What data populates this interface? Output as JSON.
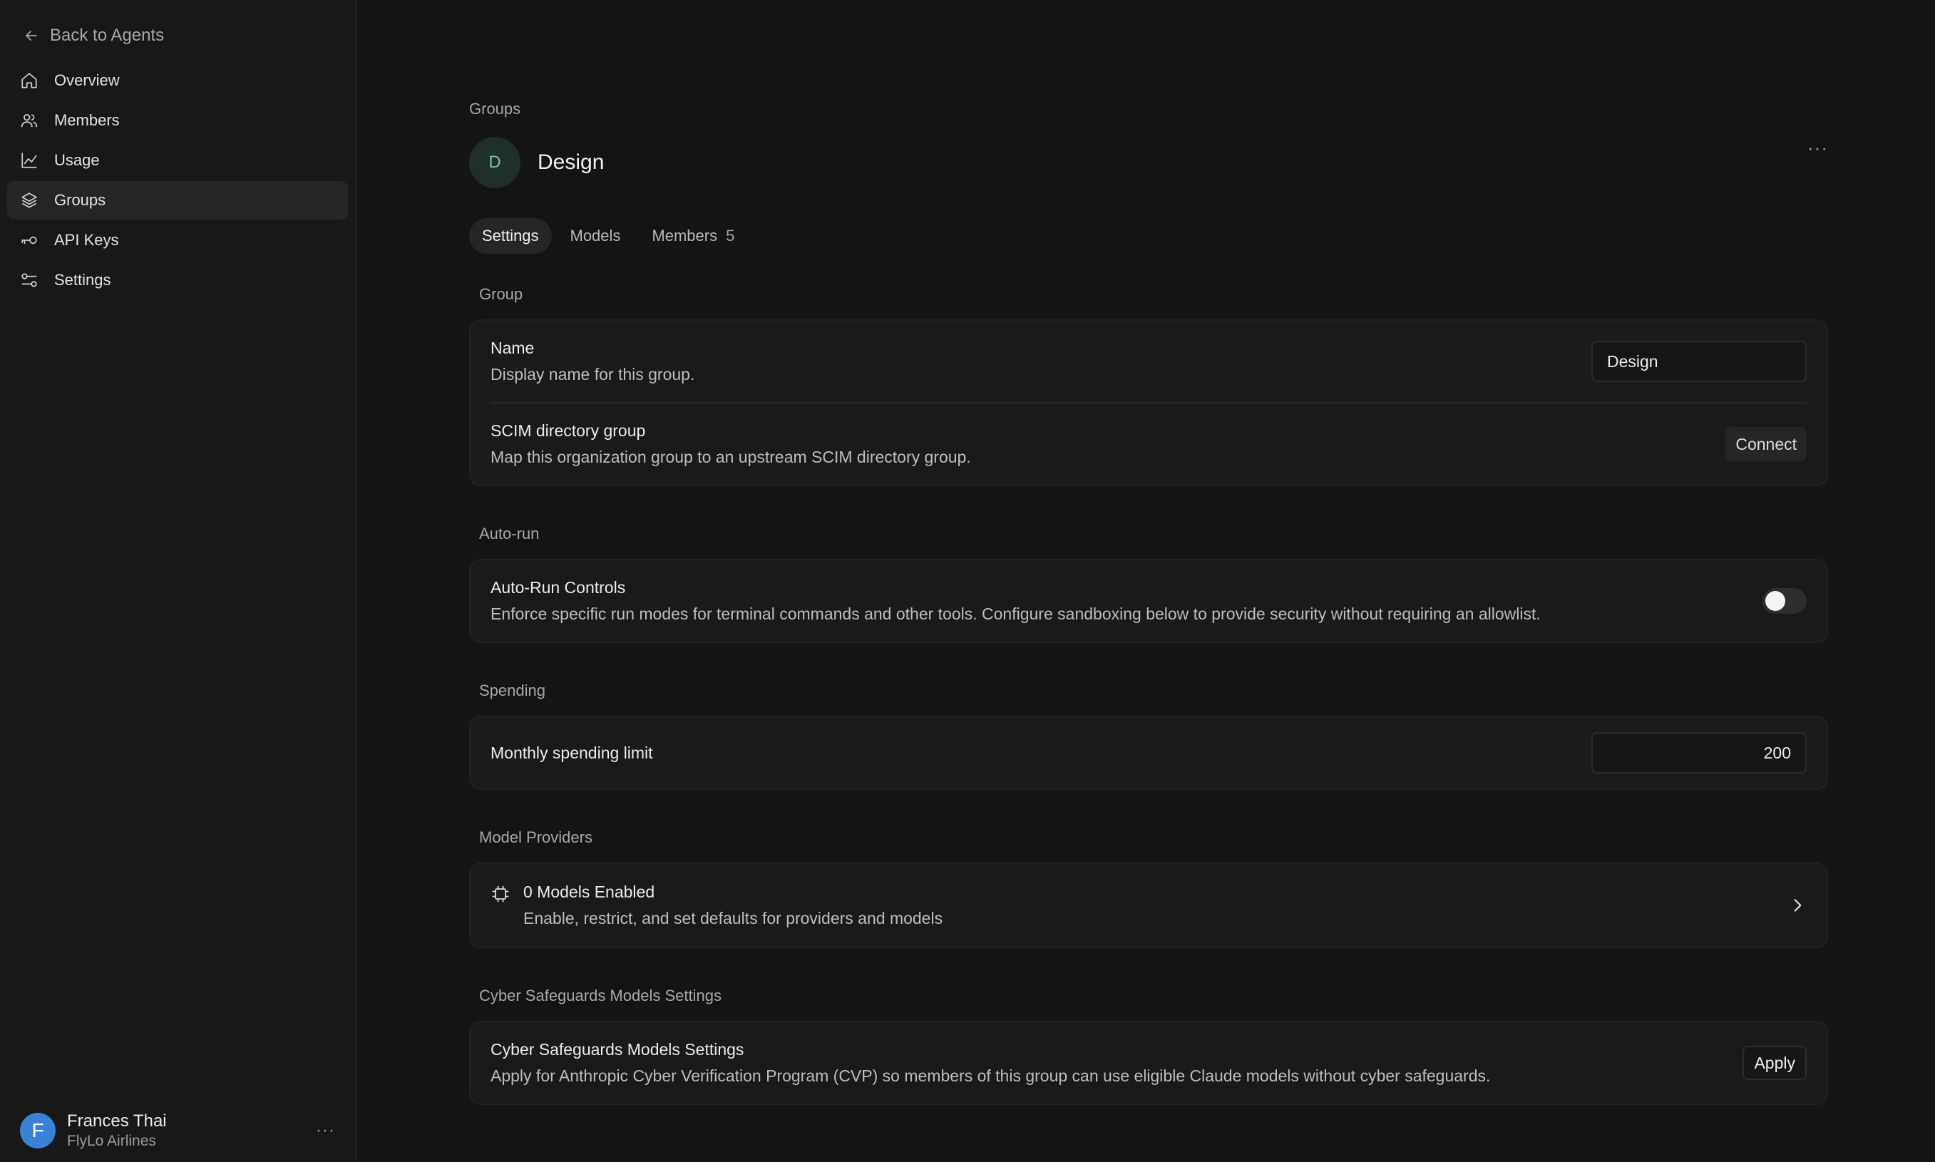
{
  "sidebar": {
    "back_label": "Back to Agents",
    "items": [
      {
        "label": "Overview",
        "icon": "home-icon",
        "active": false
      },
      {
        "label": "Members",
        "icon": "users-icon",
        "active": false
      },
      {
        "label": "Usage",
        "icon": "chart-line-icon",
        "active": false
      },
      {
        "label": "Groups",
        "icon": "layers-icon",
        "active": true
      },
      {
        "label": "API Keys",
        "icon": "key-icon",
        "active": false
      },
      {
        "label": "Settings",
        "icon": "sliders-icon",
        "active": false
      }
    ],
    "user": {
      "initial": "F",
      "name": "Frances Thai",
      "org": "FlyLo Airlines",
      "menu_label": "···"
    }
  },
  "main": {
    "breadcrumb": "Groups",
    "group": {
      "initial": "D",
      "name": "Design",
      "more_label": "···"
    },
    "tabs": [
      {
        "label": "Settings",
        "active": true,
        "count": ""
      },
      {
        "label": "Models",
        "active": false,
        "count": ""
      },
      {
        "label": "Members",
        "active": false,
        "count": "5"
      }
    ],
    "sections": {
      "group": {
        "label": "Group",
        "name_title": "Name",
        "name_desc": "Display name for this group.",
        "name_value": "Design",
        "scim_title": "SCIM directory group",
        "scim_desc": "Map this organization group to an upstream SCIM directory group.",
        "scim_button": "Connect"
      },
      "autorun": {
        "label": "Auto-run",
        "title": "Auto-Run Controls",
        "desc": "Enforce specific run modes for terminal commands and other tools. Configure sandboxing below to provide security without requiring an allowlist.",
        "enabled": false
      },
      "spending": {
        "label": "Spending",
        "title": "Monthly spending limit",
        "value": "200"
      },
      "providers": {
        "label": "Model Providers",
        "title": "0 Models Enabled",
        "desc": "Enable, restrict, and set defaults for providers and models"
      },
      "cyber": {
        "label": "Cyber Safeguards Models Settings",
        "title": "Cyber Safeguards Models Settings",
        "desc": "Apply for Anthropic Cyber Verification Program (CVP) so members of this group can use eligible Claude models without cyber safeguards.",
        "button": "Apply"
      }
    }
  },
  "colors": {
    "background": "#141414",
    "sidebar": "#181818",
    "card": "#1a1a1a",
    "user_avatar": "#3b82d6",
    "group_avatar": "#1f2f2c"
  }
}
